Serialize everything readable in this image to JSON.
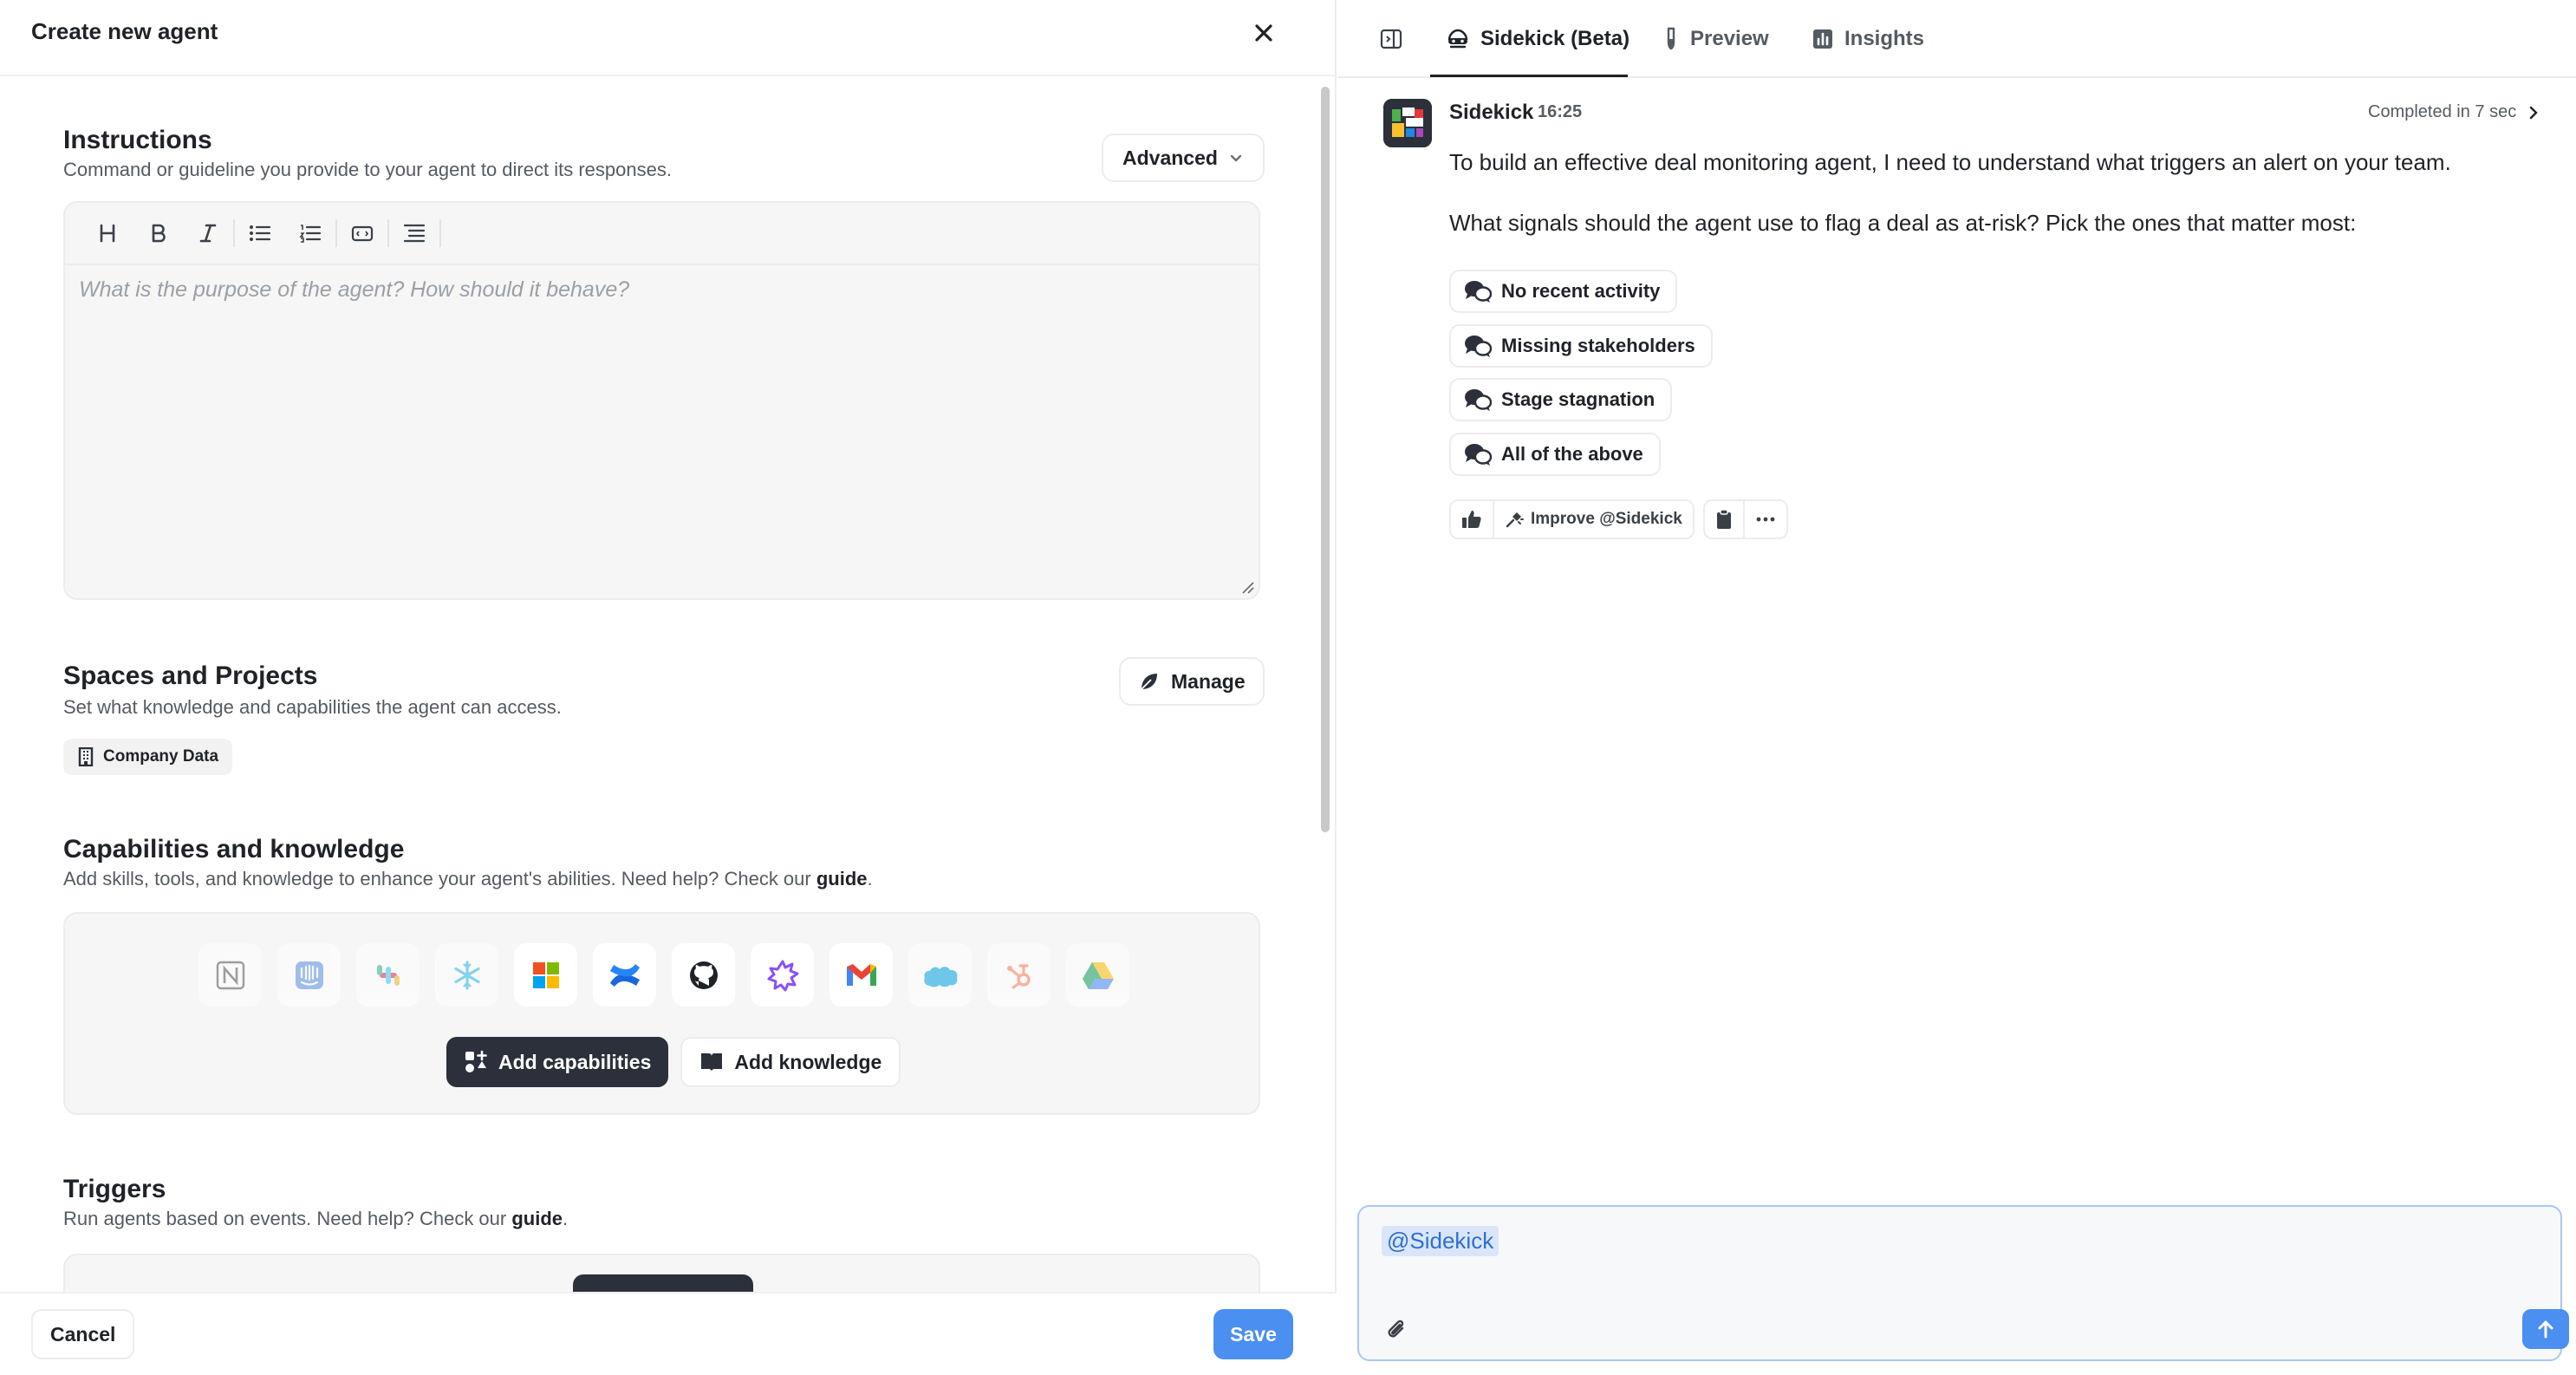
{
  "left": {
    "title": "Create new agent",
    "instructions": {
      "title": "Instructions",
      "subtitle": "Command or guideline you provide to your agent to direct its responses.",
      "mode_label": "Advanced",
      "placeholder": "What is the purpose of the agent? How should it behave?"
    },
    "spaces": {
      "title": "Spaces and Projects",
      "subtitle": "Set what knowledge and capabilities the agent can access.",
      "manage_label": "Manage",
      "chip_label": "Company Data"
    },
    "capabilities": {
      "title": "Capabilities and knowledge",
      "subtitle_pre": "Add skills, tools, and knowledge to enhance your agent's abilities. Need help? Check our ",
      "subtitle_link": "guide",
      "subtitle_post": ".",
      "integrations": [
        "notion-icon",
        "intercom-icon",
        "slack-icon",
        "snowflake-icon",
        "microsoft-icon",
        "confluence-icon",
        "github-icon",
        "zendesk-icon",
        "gmail-icon",
        "salesforce-icon",
        "hubspot-icon",
        "google-drive-icon"
      ],
      "add_capabilities_label": "Add capabilities",
      "add_knowledge_label": "Add knowledge"
    },
    "triggers": {
      "title": "Triggers",
      "subtitle_pre": "Run agents based on events. Need help? Check our ",
      "subtitle_link": "guide",
      "subtitle_post": "."
    },
    "footer": {
      "cancel_label": "Cancel",
      "save_label": "Save"
    }
  },
  "right": {
    "tabs": [
      {
        "label": "Sidekick (Beta)",
        "icon": "sidekick-icon",
        "active": true
      },
      {
        "label": "Preview",
        "icon": "flask-icon",
        "active": false
      },
      {
        "label": "Insights",
        "icon": "bar-chart-icon",
        "active": false
      }
    ],
    "message": {
      "author": "Sidekick",
      "time": "16:25",
      "completed": "Completed in 7 sec",
      "text1": "To build an effective deal monitoring agent, I need to understand what triggers an alert on your team.",
      "text2": "What signals should the agent use to flag a deal as at-risk? Pick the ones that matter most:",
      "options": [
        "No recent activity",
        "Missing stakeholders",
        "Stage stagnation",
        "All of the above"
      ],
      "improve_label": "Improve @Sidekick"
    },
    "composer": {
      "mention": "@Sidekick"
    }
  },
  "colors": {
    "primary_blue": "#4b8ff0",
    "dark_button": "#2b303a",
    "border": "#ececec"
  }
}
